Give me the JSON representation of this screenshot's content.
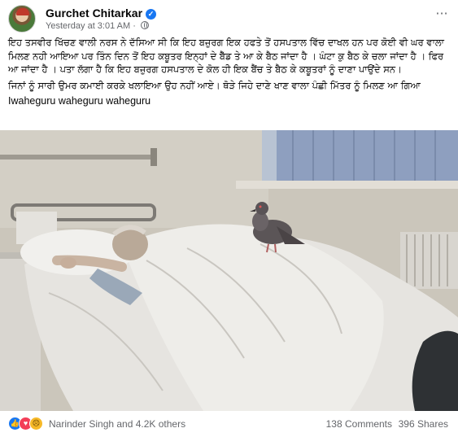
{
  "post": {
    "author": "Gurchet Chitarkar",
    "timestamp": "Yesterday at 3:01 AM",
    "separator": "·",
    "verified_symbol": "✓",
    "more_symbol": "···",
    "paragraphs": [
      "ਇਹ ਤਸਵੀਰ ਖਿੱਚਣ ਵਾਲੀ ਨਰਸ ਨੇ ਦੱਸਿਆ ਸੀ ਕਿ ਇਹ ਬਜ਼ੁਰਗ ਇਕ ਹਫਤੇ ਤੋਂ ਹਸਪਤਾਲ ਵਿੱਚ ਦਾਖਲ ਹਨ ਪਰ ਕੋਈ ਵੀ ਘਰ ਵਾਲਾ ਮਿਲਣ ਨਹੀ ਆਇਆ ਪਰ ਤਿੰਨ ਦਿਨ ਤੋਂ ਇਹ ਕਬੂਤਰ ਇਨ੍ਹਾਂ ਦੇ ਬੈੱਡ ਤੇ ਆ ਕੇ ਬੈਠ ਜਾਂਦਾ ਹੈ । ਘੰਟਾ ਕੁ ਬੈਠ ਕੇ ਚਲਾ ਜਾਂਦਾ ਹੈ । ਫਿਰ ਆ ਜਾਂਦਾ ਹੈ । ਪਤਾ ਲੱਗਾ ਹੈ ਕਿ ਇਹ ਬਜ਼ੁਰਗ ਹਸਪਤਾਲ ਦੇ ਕੋਲ ਹੀ ਇਕ ਬੈਂਚ ਤੇ ਬੈਠ ਕੇ ਕਬੂਤਰਾਂ ਨੂੰ ਦਾਣਾ ਪਾਉਂਦੇ ਸਨ।",
      "ਜਿਨਾਂ ਨੂੰ ਸਾਰੀ ਉਮਰ ਕਮਾਈ ਕਰਕੇ ਖਲਾਇਆ ਉਹ ਨਹੀਂ ਆਏ। ਥੋੜੇ ਜਿਹੇ ਦਾਣੇ ਖਾਣ ਵਾਲਾ ਪੰਛੀ ਮਿੱਤਰ ਨੂੰ ਮਿਲਣ ਆ ਗਿਆ",
      "Iwaheguru waheguru waheguru"
    ]
  },
  "photo": {
    "alt_icon": "pigeon-on-hospital-bed-photo",
    "colors": {
      "wall": "#cbc6bb",
      "sheet": "#e6e4e0",
      "curtain": "#8e9fbf",
      "pigeon": "#5b5557"
    }
  },
  "footer": {
    "reaction_icons": [
      "like-icon",
      "love-icon",
      "sad-icon"
    ],
    "like_symbol": "👍",
    "love_symbol": "♥",
    "sad_symbol": "☹",
    "reactors": "Narinder Singh and 4.2K others",
    "comments": "138 Comments",
    "shares": "396 Shares"
  },
  "colors": {
    "accent": "#1877f2",
    "secondary_text": "#65676b",
    "love": "#f33e58",
    "sad": "#f7b928"
  }
}
